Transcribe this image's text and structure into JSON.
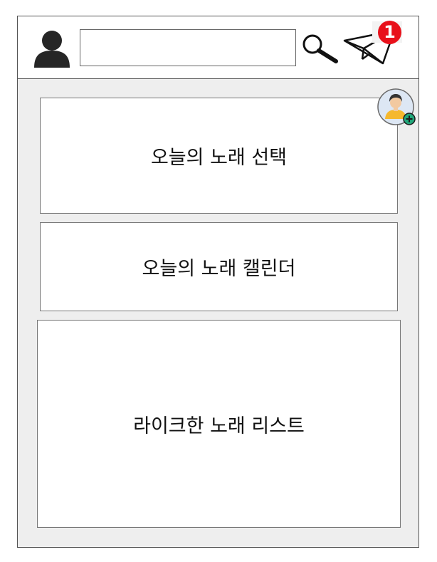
{
  "header": {
    "search": {
      "value": "",
      "placeholder": ""
    },
    "notification_count": "1",
    "icons": {
      "profile": "user-silhouette-icon",
      "search": "magnifier-icon",
      "messages": "paper-plane-icon",
      "add_friend": "user-plus-icon"
    }
  },
  "menu": {
    "items": [
      {
        "label": "오늘의 노래 선택"
      },
      {
        "label": "오늘의 노래 캘린더"
      },
      {
        "label": "라이크한 노래 리스트"
      }
    ]
  },
  "colors": {
    "badge": "#e8101a",
    "background": "#eeeeee",
    "add_badge": "#22a67a"
  }
}
